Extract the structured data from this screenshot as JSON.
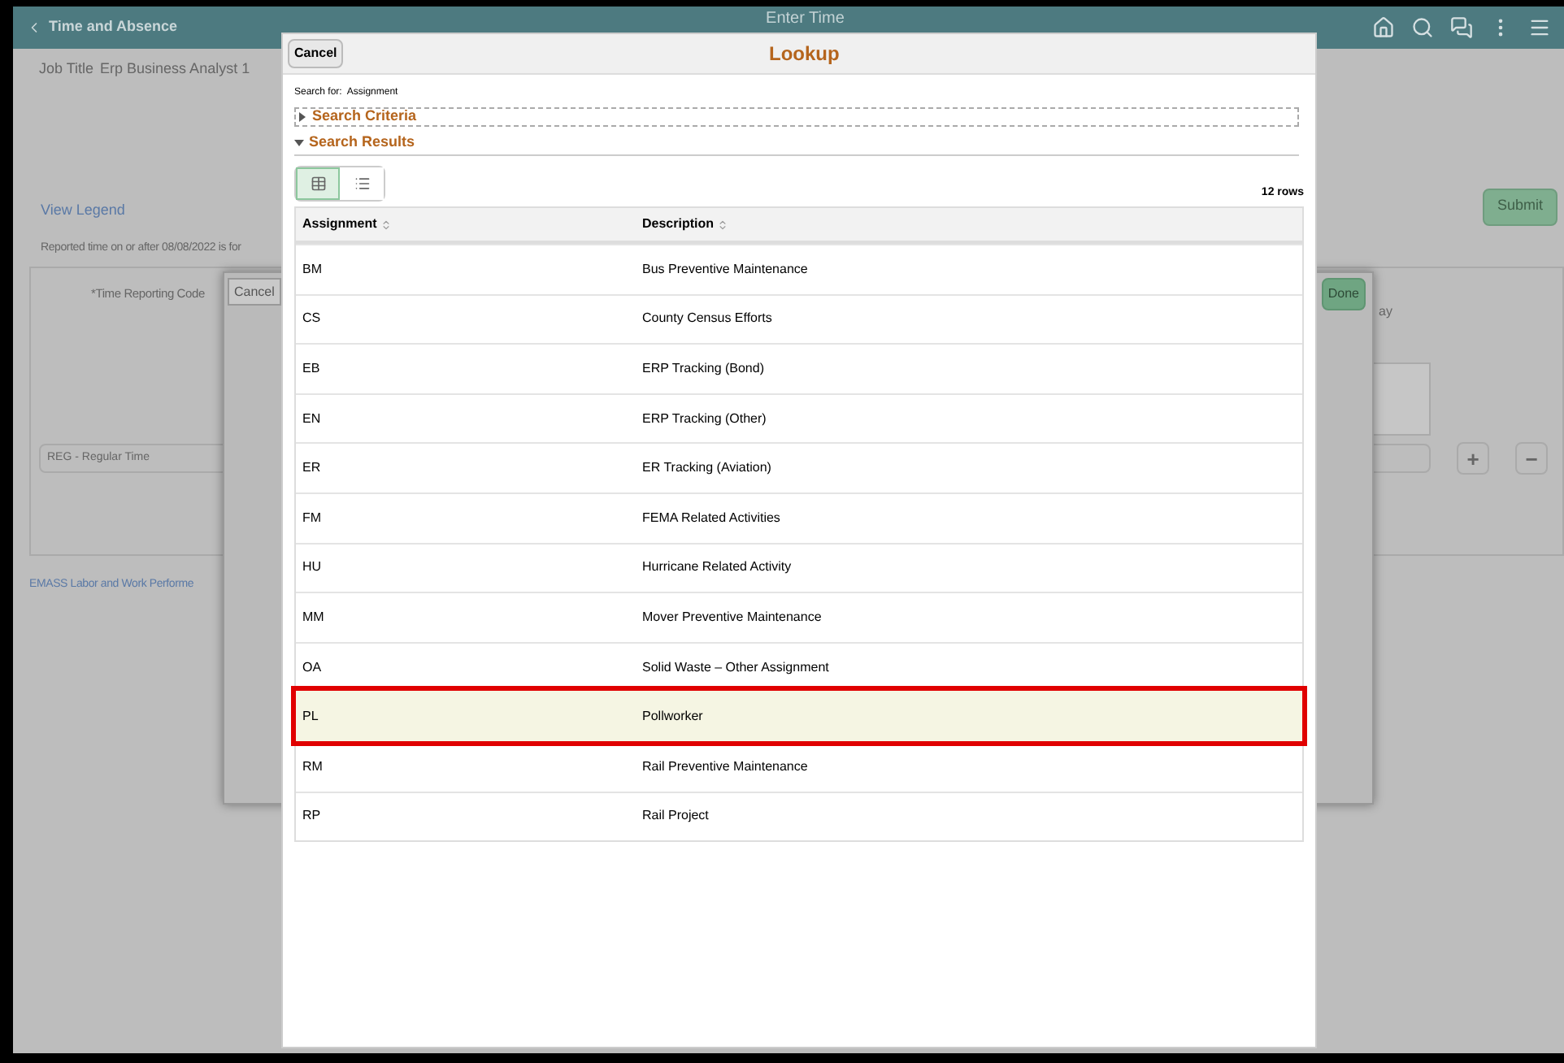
{
  "header": {
    "back_link": "Time and Absence",
    "title": "Enter Time"
  },
  "page": {
    "job_title_label": "Job Title",
    "job_title": "Erp Business Analyst 1",
    "view_legend": "View Legend",
    "reported_notice": "Reported time on or after 08/08/2022 is for",
    "submit": "Submit",
    "time_reporting_code_label": "*Time Reporting Code",
    "time_reporting_code_value": "REG - Regular Time",
    "labor_link": "EMASS Labor and Work Performe",
    "column_text": "ay",
    "add_button": "+",
    "remove_button": "−"
  },
  "secondary_dialog": {
    "cancel": "Cancel",
    "done": "Done"
  },
  "lookup": {
    "cancel": "Cancel",
    "title": "Lookup",
    "search_for_label": "Search for:",
    "search_for": "Assignment",
    "sections": [
      {
        "label": "Search Criteria",
        "expanded": false
      },
      {
        "label": "Search Results",
        "expanded": true
      }
    ],
    "views": [
      {
        "kind": "grid",
        "selected": true
      },
      {
        "kind": "list",
        "selected": false
      }
    ],
    "row_count": "12 rows",
    "columns": [
      "Assignment",
      "Description"
    ],
    "rows": [
      {
        "assignment": "BM",
        "description": "Bus Preventive Maintenance",
        "selected": false
      },
      {
        "assignment": "CS",
        "description": "County Census Efforts",
        "selected": false
      },
      {
        "assignment": "EB",
        "description": "ERP Tracking (Bond)",
        "selected": false
      },
      {
        "assignment": "EN",
        "description": "ERP Tracking (Other)",
        "selected": false
      },
      {
        "assignment": "ER",
        "description": "ER Tracking (Aviation)",
        "selected": false
      },
      {
        "assignment": "FM",
        "description": "FEMA Related Activities",
        "selected": false
      },
      {
        "assignment": "HU",
        "description": "Hurricane Related Activity",
        "selected": false
      },
      {
        "assignment": "MM",
        "description": "Mover Preventive Maintenance",
        "selected": false
      },
      {
        "assignment": "OA",
        "description": "Solid Waste – Other Assignment",
        "selected": false
      },
      {
        "assignment": "PL",
        "description": "Pollworker",
        "selected": true
      },
      {
        "assignment": "RM",
        "description": "Rail Preventive Maintenance",
        "selected": false
      },
      {
        "assignment": "RP",
        "description": "Rail Project",
        "selected": false
      }
    ]
  }
}
